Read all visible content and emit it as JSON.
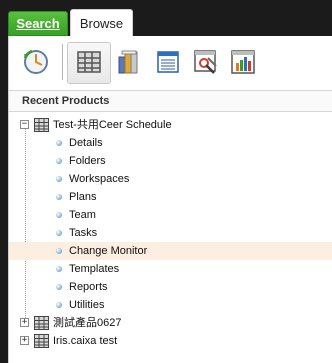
{
  "tabs": {
    "search_label": "Search",
    "browse_label": "Browse"
  },
  "toolbar": {
    "buttons": [
      {
        "name": "recent-clock-icon"
      },
      {
        "name": "products-grid-icon",
        "active": true
      },
      {
        "name": "columns-chart-icon"
      },
      {
        "name": "document-list-icon"
      },
      {
        "name": "tools-window-icon"
      },
      {
        "name": "bar-chart-window-icon"
      }
    ]
  },
  "section": {
    "title": "Recent Products"
  },
  "tree": {
    "products": [
      {
        "label": "Test-共用Ceer Schedule",
        "expanded": true,
        "children": [
          "Details",
          "Folders",
          "Workspaces",
          "Plans",
          "Team",
          "Tasks",
          "Change Monitor",
          "Templates",
          "Reports",
          "Utilities"
        ],
        "highlighted_child": "Change Monitor"
      },
      {
        "label": "測試產品0627",
        "expanded": false
      },
      {
        "label": "Iris.caixa test",
        "expanded": false
      }
    ]
  },
  "colors": {
    "search_tab": "#3aa027",
    "highlight_row": "#fbefe1",
    "background": "#1b1b1b"
  }
}
